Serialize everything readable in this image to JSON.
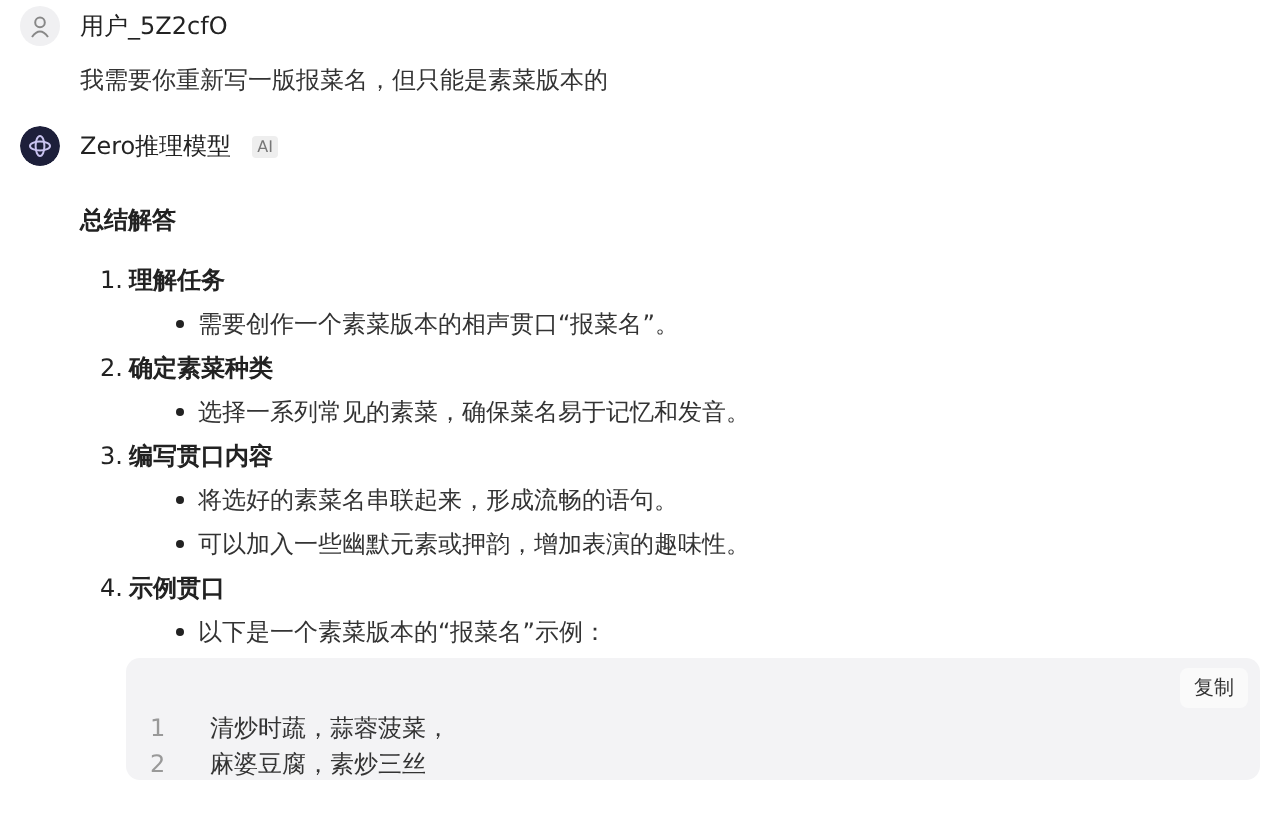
{
  "user": {
    "name": "用户_5Z2cfO",
    "message": "我需要你重新写一版报菜名，但只能是素菜版本的"
  },
  "bot": {
    "name": "Zero推理模型",
    "badge": "AI",
    "heading": "总结解答",
    "steps": [
      {
        "number": "1.",
        "title": "理解任务",
        "bullets": [
          "需要创作一个素菜版本的相声贯口“报菜名”。"
        ]
      },
      {
        "number": "2.",
        "title": "确定素菜种类",
        "bullets": [
          "选择一系列常见的素菜，确保菜名易于记忆和发音。"
        ]
      },
      {
        "number": "3.",
        "title": "编写贯口内容",
        "bullets": [
          "将选好的素菜名串联起来，形成流畅的语句。",
          "可以加入一些幽默元素或押韵，增加表演的趣味性。"
        ]
      },
      {
        "number": "4.",
        "title": "示例贯口",
        "bullets": [
          "以下是一个素菜版本的“报菜名”示例："
        ]
      }
    ],
    "code": {
      "copy_label": "复制",
      "lines": [
        {
          "number": "1",
          "text": "清炒时蔬，蒜蓉菠菜，"
        },
        {
          "number": "2",
          "text": "麻婆豆腐，素炒三丝"
        }
      ]
    }
  }
}
